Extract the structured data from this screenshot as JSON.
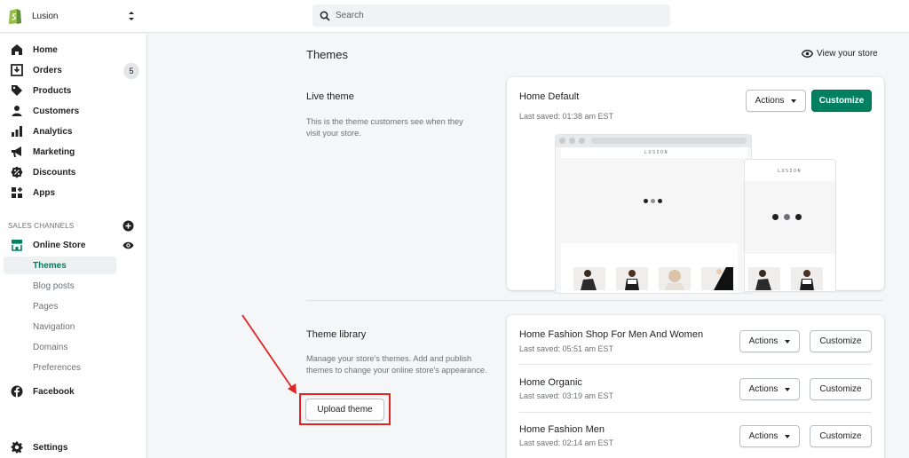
{
  "topbar": {
    "store_name": "Lusion",
    "search_placeholder": "Search"
  },
  "sidebar": {
    "items": [
      {
        "label": "Home",
        "icon": "home-icon"
      },
      {
        "label": "Orders",
        "icon": "orders-icon",
        "badge": "5"
      },
      {
        "label": "Products",
        "icon": "tag-icon"
      },
      {
        "label": "Customers",
        "icon": "person-icon"
      },
      {
        "label": "Analytics",
        "icon": "bar-chart-icon"
      },
      {
        "label": "Marketing",
        "icon": "megaphone-icon"
      },
      {
        "label": "Discounts",
        "icon": "discount-icon"
      },
      {
        "label": "Apps",
        "icon": "apps-icon"
      }
    ],
    "sales_channels_label": "SALES CHANNELS",
    "online_store": "Online Store",
    "online_store_sub": [
      "Themes",
      "Blog posts",
      "Pages",
      "Navigation",
      "Domains",
      "Preferences"
    ],
    "facebook": "Facebook",
    "settings": "Settings"
  },
  "main": {
    "page_title": "Themes",
    "view_store": "View your store",
    "live_theme": {
      "title": "Live theme",
      "description": "This is the theme customers see when they visit your store.",
      "name": "Home Default",
      "saved": "Last saved: 01:38 am EST",
      "actions_label": "Actions",
      "customize_label": "Customize",
      "preview_brand": "LUSION"
    },
    "library": {
      "title": "Theme library",
      "description": "Manage your store's themes. Add and publish themes to change your online store's appearance.",
      "upload_label": "Upload theme",
      "themes": [
        {
          "name": "Home Fashion Shop For Men And Women",
          "saved": "Last saved: 05:51 am EST"
        },
        {
          "name": "Home Organic",
          "saved": "Last saved: 03:19 am EST"
        },
        {
          "name": "Home Fashion Men",
          "saved": "Last saved: 02:14 am EST"
        }
      ],
      "actions_label": "Actions",
      "customize_label": "Customize"
    }
  },
  "colors": {
    "primary": "#008060",
    "annotation": "#e02424"
  }
}
